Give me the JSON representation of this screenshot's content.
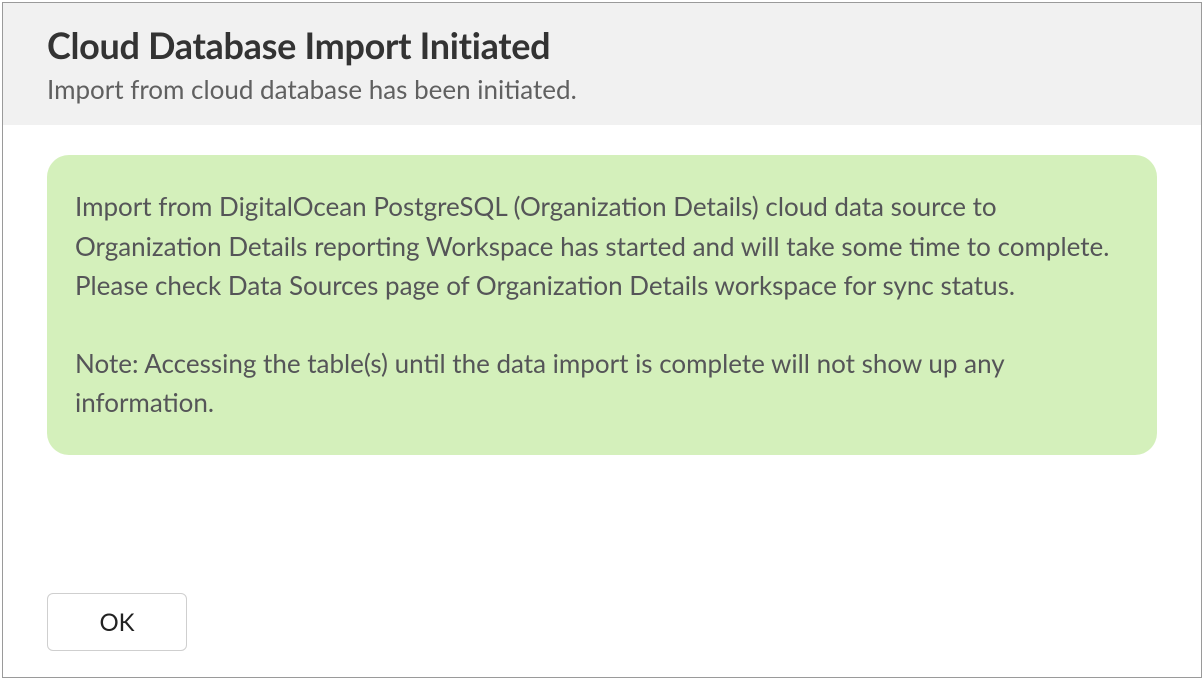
{
  "header": {
    "title": "Cloud Database Import Initiated",
    "subtitle": "Import from cloud database has been initiated."
  },
  "message": {
    "paragraph1": "Import from DigitalOcean PostgreSQL (Organization Details) cloud data source to Organization Details reporting Workspace has started and will take some time to complete. Please check Data Sources page of Organization Details workspace for sync status.",
    "paragraph2": "Note: Accessing the table(s) until the data import is complete will not show up any information."
  },
  "footer": {
    "ok_label": "OK"
  }
}
